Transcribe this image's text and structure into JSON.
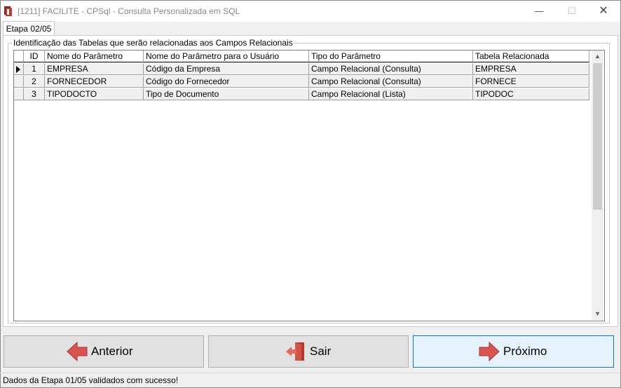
{
  "window": {
    "title": "[1211] FACILITE - CPSql - Consulta Personalizada em SQL",
    "minimize": "—",
    "maximize": "☐",
    "close": "✕",
    "icon": "facilite-app-icon"
  },
  "tab": {
    "label": "Etapa 02/05"
  },
  "group": {
    "title": "Identificação das Tabelas que serão relacionadas aos Campos Relacionais"
  },
  "grid": {
    "columns": [
      "ID",
      "Nome do Parâmetro",
      "Nome do Parâmetro para o Usuário",
      "Tipo do Parâmetro",
      "Tabela Relacionada"
    ],
    "rows": [
      {
        "id": "1",
        "nome": "EMPRESA",
        "nome_usuario": "Código da Empresa",
        "tipo": "Campo Relacional (Consulta)",
        "tabela": "EMPRESA"
      },
      {
        "id": "2",
        "nome": "FORNECEDOR",
        "nome_usuario": "Código do Fornecedor",
        "tipo": "Campo Relacional (Consulta)",
        "tabela": "FORNECE"
      },
      {
        "id": "3",
        "nome": "TIPODOCTO",
        "nome_usuario": "Tipo de Documento",
        "tipo": "Campo Relacional (Lista)",
        "tabela": "TIPODOC"
      }
    ],
    "scroll_up": "▲",
    "scroll_down": "▼"
  },
  "buttons": {
    "anterior": "Anterior",
    "sair": "Sair",
    "proximo": "Próximo"
  },
  "status": "Dados da Etapa 01/05 validados com sucesso!",
  "colors": {
    "arrow_red": "#d9534f",
    "accent_border": "#0078d7"
  }
}
